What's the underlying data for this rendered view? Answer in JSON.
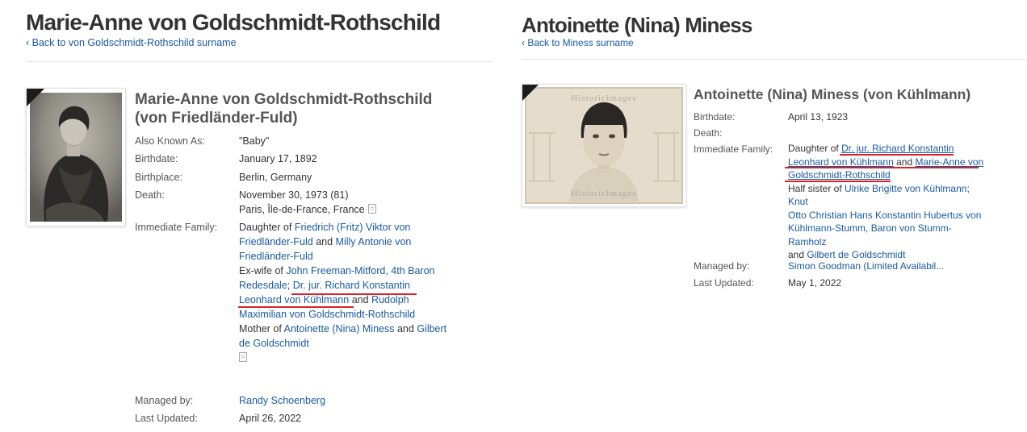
{
  "left": {
    "title": "Marie-Anne von Goldschmidt-Rothschild",
    "back_link": "‹ Back to von Goldschmidt-Rothschild surname",
    "full_name_line1": "Marie-Anne von Goldschmidt-Rothschild",
    "full_name_line2": "(von Friedländer-Fuld)",
    "labels": {
      "aka": "Also Known As:",
      "birthdate": "Birthdate:",
      "birthplace": "Birthplace:",
      "death": "Death:",
      "family": "Immediate Family:",
      "managed_by": "Managed by:",
      "last_updated": "Last Updated:"
    },
    "aka": "\"Baby\"",
    "birthdate": "January 17, 1892",
    "birthplace": "Berlin, Germany",
    "death_date": "November 30, 1973 (81)",
    "death_place": "Paris, Île-de-France, France",
    "family": {
      "daughter_of": "Daughter of",
      "father_a": "Friedrich (Fritz) Viktor von",
      "father_b": "Friedländer-Fuld",
      "and1": "and",
      "mother_a": "Milly Antonie von",
      "mother_b": "Friedländer-Fuld",
      "exwife_of": "Ex-wife of",
      "ex1_a": "John Freeman-Mitford, 4th Baron",
      "ex1_b": "Redesdale",
      "sep": ";",
      "ex2_a": "Dr. jur. Richard Konstantin",
      "ex2_b": "Leonhard von Kühlmann",
      "and2": "and",
      "ex3_a": "Rudolph",
      "ex3_b": "Maximilian von Goldschmidt-Rothschild",
      "mother_of": "Mother of",
      "child1": "Antoinette (Nina) Miness",
      "and3": "and",
      "child2_a": "Gilbert",
      "child2_b": "de Goldschmidt"
    },
    "managed_by": "Randy Schoenberg",
    "last_updated": "April 26, 2022"
  },
  "right": {
    "title": "Antoinette (Nina) Miness",
    "back_link": "‹ Back to Miness surname",
    "full_name": "Antoinette (Nina) Miness (von Kühlmann)",
    "labels": {
      "birthdate": "Birthdate:",
      "death": "Death:",
      "family": "Immediate Family:",
      "managed_by": "Managed by:",
      "last_updated": "Last Updated:"
    },
    "birthdate": "April 13, 1923",
    "death": "",
    "family": {
      "daughter_of": "Daughter of",
      "father_a": "Dr. jur. Richard Konstantin",
      "father_b": "Leonhard von Kühlmann",
      "and1": "and",
      "mother_a": "Marie-Anne von",
      "mother_b": "Goldschmidt-Rothschild",
      "half_sister_of": "Half sister of",
      "sib1": "Ulrike Brigitte von Kühlmann",
      "sep": ";",
      "sib2_a": "Knut",
      "sib2_b": "Otto Christian Hans Konstantin Hubertus von",
      "sib2_c": "Kühlmann-Stumm, Baron von Stumm-Ramholz",
      "and2": "and",
      "sib3": "Gilbert de Goldschmidt"
    },
    "watermark": "HistoricImages",
    "managed_by": "Simon Goodman (Limited Availabil...",
    "last_updated": "May 1, 2022"
  },
  "colors": {
    "link": "#1a5aa0",
    "annotation_underline": "#d6232a",
    "title": "#333333"
  }
}
